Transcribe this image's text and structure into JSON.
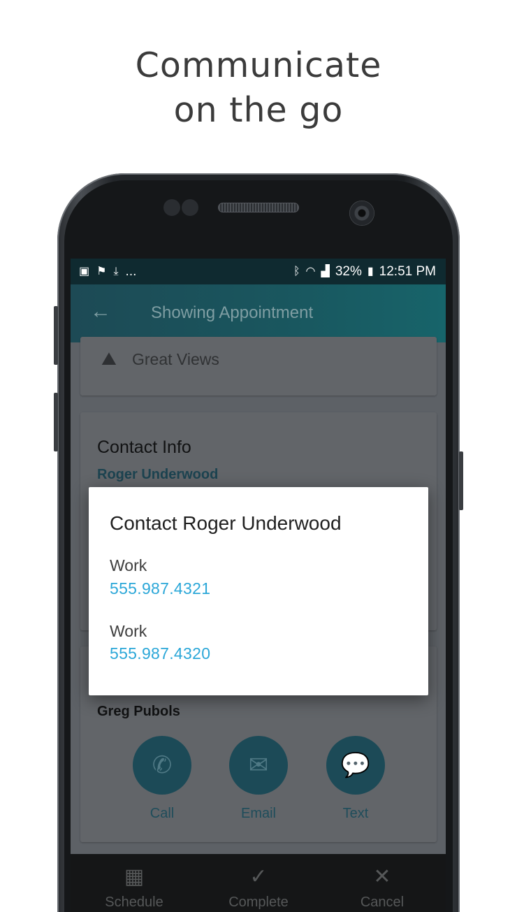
{
  "headline": {
    "line1": "Communicate",
    "line2": "on the go"
  },
  "status_bar": {
    "battery": "32%",
    "time": "12:51 PM",
    "overflow": "..."
  },
  "app_bar": {
    "title": "Showing Appointment"
  },
  "property": {
    "feature_label": "Great Views"
  },
  "contact_card": {
    "heading": "Contact Info",
    "name": "Roger Underwood"
  },
  "agent_card": {
    "name": "Greg Pubols",
    "actions": [
      {
        "label": "Call",
        "icon": "phone-icon"
      },
      {
        "label": "Email",
        "icon": "envelope-icon"
      },
      {
        "label": "Text",
        "icon": "chat-icon"
      }
    ]
  },
  "bottom_bar": {
    "items": [
      {
        "label": "Schedule",
        "icon": "calendar-icon"
      },
      {
        "label": "Complete",
        "icon": "check-icon"
      },
      {
        "label": "Cancel",
        "icon": "close-icon"
      }
    ]
  },
  "dialog": {
    "title": "Contact Roger Underwood",
    "entries": [
      {
        "label": "Work",
        "phone": "555.987.4321"
      },
      {
        "label": "Work",
        "phone": "555.987.4320"
      }
    ]
  },
  "colors": {
    "link": "#2ba7d8",
    "appbar": "#19575f",
    "statusbar": "#0f2a30"
  }
}
